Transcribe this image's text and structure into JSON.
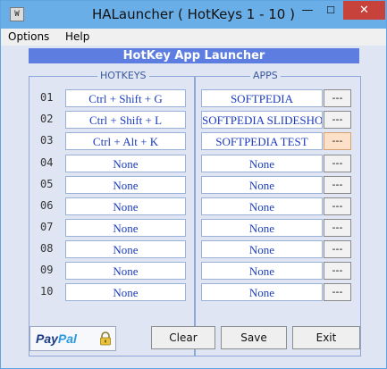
{
  "window": {
    "title": "HALauncher  ( HotKeys 1 - 10 )"
  },
  "menu": [
    "Options",
    "Help"
  ],
  "banner": "HotKey App Launcher",
  "groups": {
    "hotkeys": "HOTKEYS",
    "apps": "APPS"
  },
  "rows": [
    {
      "num": "01",
      "hotkey": "Ctrl + Shift + G",
      "app": "SOFTPEDIA",
      "browse": "---"
    },
    {
      "num": "02",
      "hotkey": "Ctrl + Shift + L",
      "app": "SOFTPEDIA SLIDESHOW",
      "browse": "---"
    },
    {
      "num": "03",
      "hotkey": "Ctrl + Alt + K",
      "app": "SOFTPEDIA TEST",
      "browse": "---"
    },
    {
      "num": "04",
      "hotkey": "None",
      "app": "None",
      "browse": "---"
    },
    {
      "num": "05",
      "hotkey": "None",
      "app": "None",
      "browse": "---"
    },
    {
      "num": "06",
      "hotkey": "None",
      "app": "None",
      "browse": "---"
    },
    {
      "num": "07",
      "hotkey": "None",
      "app": "None",
      "browse": "---"
    },
    {
      "num": "08",
      "hotkey": "None",
      "app": "None",
      "browse": "---"
    },
    {
      "num": "09",
      "hotkey": "None",
      "app": "None",
      "browse": "---"
    },
    {
      "num": "10",
      "hotkey": "None",
      "app": "None",
      "browse": "---"
    }
  ],
  "paypal": {
    "pay": "Pay",
    "pal": "Pal"
  },
  "buttons": {
    "clear": "Clear",
    "save": "Save",
    "exit": "Exit"
  },
  "colors": {
    "titlebar": "#6aaee8",
    "banner": "#5d7ee0",
    "field_text": "#1b3cc0",
    "close": "#c7423a"
  }
}
